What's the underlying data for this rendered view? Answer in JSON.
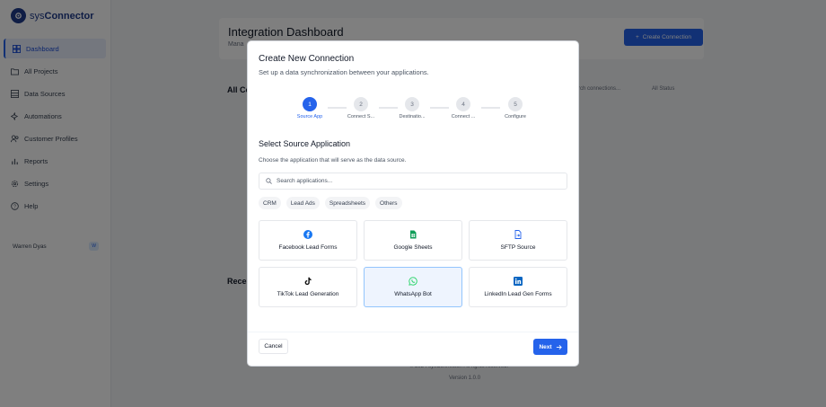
{
  "app": {
    "logo_prefix": "sys",
    "logo_name": "Connector"
  },
  "sidebar": {
    "items": [
      {
        "label": "Dashboard",
        "icon": "grid-icon",
        "active": true
      },
      {
        "label": "All Projects",
        "icon": "folder-icon"
      },
      {
        "label": "Data Sources",
        "icon": "database-icon"
      },
      {
        "label": "Automations",
        "icon": "bolt-icon"
      },
      {
        "label": "Customer Profiles",
        "icon": "users-icon"
      },
      {
        "label": "Reports",
        "icon": "chart-icon"
      },
      {
        "label": "Settings",
        "icon": "gear-icon"
      },
      {
        "label": "Help",
        "icon": "help-icon"
      }
    ],
    "user": {
      "name": "Warren Dyas",
      "badge": "W"
    }
  },
  "background": {
    "page_title": "Integration Dashboard",
    "page_subtitle": "Mana",
    "create_button": "Create Connection",
    "section_all": "All Co",
    "search_placeholder": "rch connections...",
    "status_filter": "All Status",
    "section_recent": "Recer",
    "footer_copyright": "© 2024 sysConnector. All rights reserved.",
    "footer_version": "Version 1.0.0"
  },
  "modal": {
    "title": "Create New Connection",
    "subtitle": "Set up a data synchronization between your applications.",
    "steps": [
      {
        "number": "1",
        "label": "Source App",
        "active": true
      },
      {
        "number": "2",
        "label": "Connect S..."
      },
      {
        "number": "3",
        "label": "Destinatio..."
      },
      {
        "number": "4",
        "label": "Connect ..."
      },
      {
        "number": "5",
        "label": "Configure"
      }
    ],
    "section_title": "Select Source Application",
    "section_desc": "Choose the application that will serve as the data source.",
    "search_placeholder": "Search applications...",
    "filters": [
      "CRM",
      "Lead Ads",
      "Spreadsheets",
      "Others"
    ],
    "apps": [
      {
        "label": "Facebook Lead Forms",
        "icon": "facebook-icon",
        "color": "#1877f2"
      },
      {
        "label": "Google Sheets",
        "icon": "google-sheets-icon",
        "color": "#0f9d58"
      },
      {
        "label": "SFTP Source",
        "icon": "file-transfer-icon",
        "color": "#2563eb"
      },
      {
        "label": "TikTok Lead Generation",
        "icon": "tiktok-icon",
        "color": "#111111"
      },
      {
        "label": "WhatsApp Bot",
        "icon": "whatsapp-icon",
        "color": "#25d366",
        "selected": true
      },
      {
        "label": "LinkedIn Lead Gen Forms",
        "icon": "linkedin-icon",
        "color": "#0a66c2"
      }
    ],
    "cancel_label": "Cancel",
    "next_label": "Next"
  },
  "colors": {
    "primary": "#2563eb",
    "overlay": "rgba(0,0,0,0.5)"
  }
}
